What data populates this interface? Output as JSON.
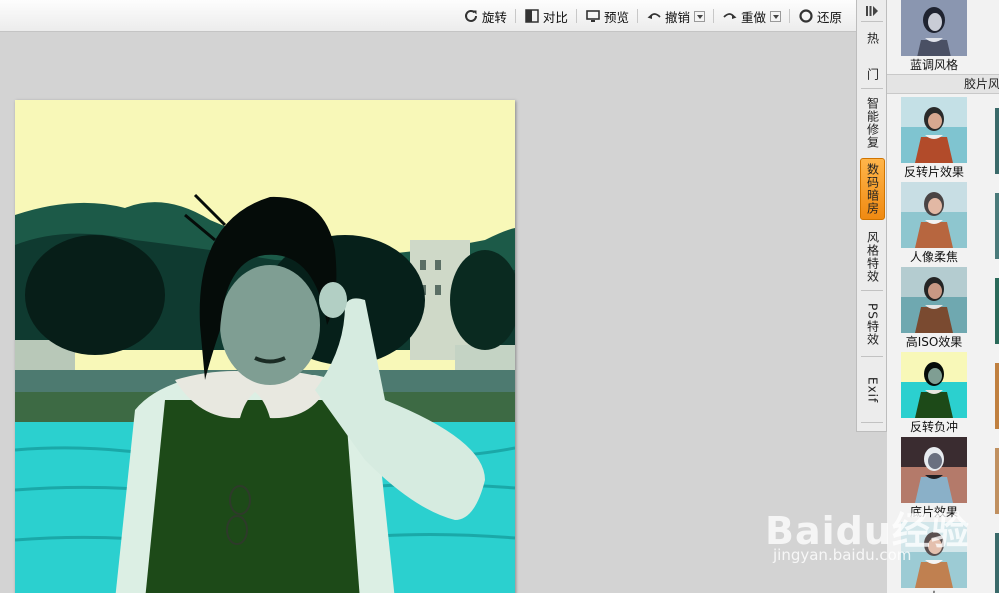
{
  "toolbar": {
    "rotate_label": "旋转",
    "compare_label": "对比",
    "preview_label": "预览",
    "undo_label": "撤销",
    "redo_label": "重做",
    "restore_label": "还原"
  },
  "vtabs": [
    {
      "label": "热"
    },
    {
      "label": "门"
    },
    {
      "label": "智能修复"
    },
    {
      "label": "数码暗房",
      "active": true
    },
    {
      "label": "风格特效"
    },
    {
      "label": "PS特效"
    },
    {
      "label": "Exif"
    }
  ],
  "panel": {
    "top_effect": "蓝调风格",
    "category": "胶片风",
    "effects": [
      "反转片效果",
      "人像柔焦",
      "高ISO效果",
      "反转负冲",
      "底片效果",
      "大"
    ]
  },
  "watermark": {
    "logo": "Baidu经验",
    "url": "jingyan.baidu.com"
  },
  "colors": {
    "active_tab": "#f39a1e",
    "canvas_bg": "#d3d3d3",
    "sky": "#f8f8b8",
    "water": "#2bd0cf"
  }
}
